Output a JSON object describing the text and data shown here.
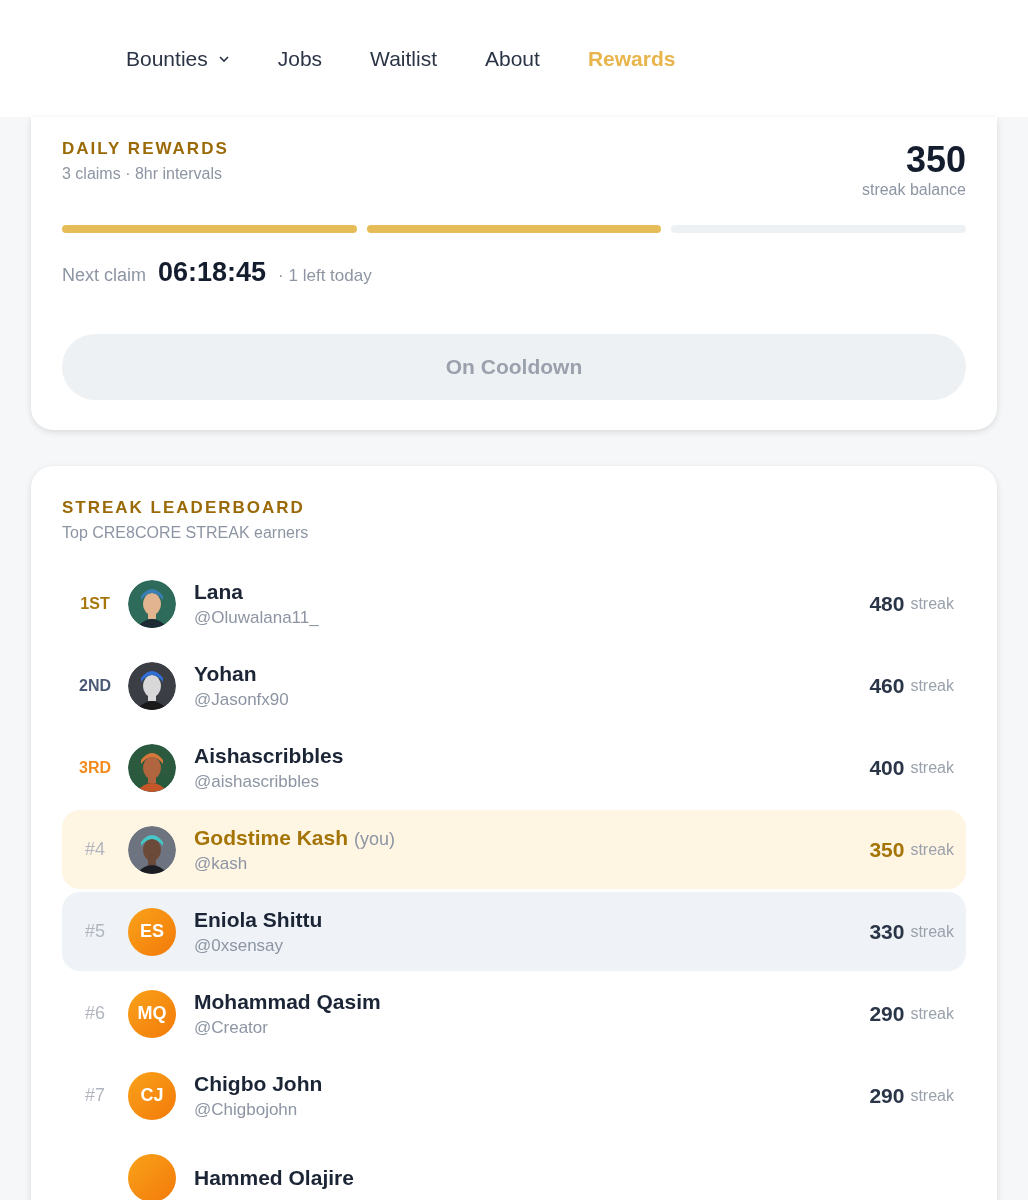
{
  "nav": [
    {
      "label": "Bounties",
      "has_menu": true,
      "selected": false
    },
    {
      "label": "Jobs",
      "has_menu": false,
      "selected": false
    },
    {
      "label": "Waitlist",
      "has_menu": false,
      "selected": false
    },
    {
      "label": "About",
      "has_menu": false,
      "selected": false
    },
    {
      "label": "Rewards",
      "has_menu": false,
      "selected": true
    }
  ],
  "daily": {
    "title": "DAILY REWARDS",
    "subtitle": "3 claims · 8hr intervals",
    "balance": "350",
    "balance_label": "streak balance",
    "segments": [
      {
        "filled": true
      },
      {
        "filled": true
      },
      {
        "filled": false
      }
    ],
    "next_label": "Next claim",
    "countdown": "06:18:45",
    "remaining": "· 1 left today",
    "button": {
      "label": "On Cooldown",
      "disabled": true
    }
  },
  "leaderboard": {
    "title": "STREAK LEADERBOARD",
    "subtitle": "Top CRE8CORE STREAK earners",
    "rows": [
      {
        "rank": "1ST",
        "color": "#a8770c",
        "name": "Lana",
        "handle": "@Oluwalana11_",
        "score": "480",
        "unit": "streak",
        "you": false,
        "highlighted": false
      },
      {
        "rank": "2ND",
        "color": "#4b5a75",
        "name": "Yohan",
        "handle": "@Jasonfx90",
        "score": "460",
        "unit": "streak",
        "you": false,
        "highlighted": false
      },
      {
        "rank": "3RD",
        "color": "#f28a1c",
        "name": "Aishascribbles",
        "handle": "@aishascribbles",
        "score": "400",
        "unit": "streak",
        "you": false,
        "highlighted": false
      },
      {
        "rank": "#4",
        "color": "#b1b6be",
        "name": "Godstime Kash",
        "you_label": "(you)",
        "handle": "@kash",
        "score": "350",
        "unit": "streak",
        "you": true,
        "highlighted": false
      },
      {
        "rank": "#5",
        "color": "#b1b6be",
        "avatar": {
          "kind": "initials",
          "initials": "ES"
        },
        "name": "Eniola Shittu",
        "handle": "@0xsensay",
        "score": "330",
        "unit": "streak",
        "you": false,
        "highlighted": true
      },
      {
        "rank": "#6",
        "color": "#b1b6be",
        "avatar": {
          "kind": "initials",
          "initials": "MQ"
        },
        "name": "Mohammad Qasim",
        "handle": "@Creator",
        "score": "290",
        "unit": "streak",
        "you": false,
        "highlighted": false
      },
      {
        "rank": "#7",
        "color": "#b1b6be",
        "avatar": {
          "kind": "initials",
          "initials": "CJ"
        },
        "name": "Chigbo John",
        "handle": "@Chigbojohn",
        "score": "290",
        "unit": "streak",
        "you": false,
        "highlighted": false
      },
      {
        "avatar": {
          "kind": "initials"
        },
        "name": "Hammed Olajire",
        "you": false,
        "highlighted": false
      }
    ]
  }
}
